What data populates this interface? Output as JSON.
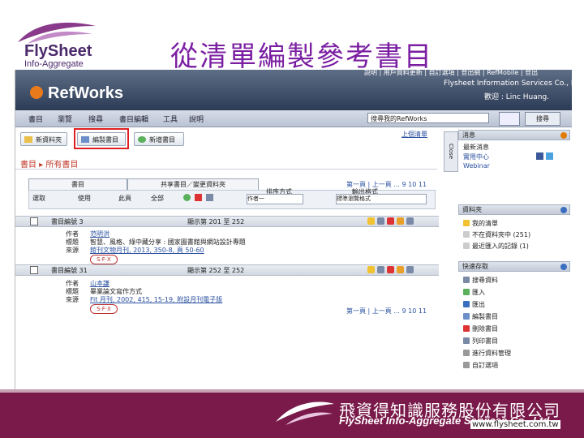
{
  "slide": {
    "logo_name": "FlySheet",
    "logo_tagline": "Info-Aggregate",
    "title": "從清單編製參考書目"
  },
  "topbar": {
    "links": "說明 | 用戶資料更新 | 自訂選項 | 登出網 | RefMobile | 登出",
    "app_name": "RefWorks",
    "org": "Flysheet Information Services Co., Ltd.",
    "user": "歡迎 : Linc Huang."
  },
  "nav": {
    "items": [
      "書目",
      "瀏覽",
      "搜尋",
      "書目編輯",
      "工具",
      "說明"
    ]
  },
  "search": {
    "value": "搜尋我的RefWorks",
    "button_label": "搜尋"
  },
  "toolbar": {
    "buttons": [
      "新資料夾",
      "編製書目",
      "新增書目"
    ],
    "last_list": "上個清單"
  },
  "breadcrumb": "書目 ▸ 所有書目",
  "tabs": [
    "書目",
    "共享書目／變更資料夾"
  ],
  "pager": "第一頁 | 上一頁 ... 9 10 11",
  "options": {
    "select_label": "選取",
    "view_label": "使用",
    "page_label": "此頁",
    "all_label": "全部",
    "sort_label": "排序方式",
    "sort_value": "作者一",
    "format_label": "輸出格式",
    "format_value": "標準瀏覽格式"
  },
  "records": [
    {
      "header": "書目編號 3",
      "range": "顯示第 201 至 252",
      "fields": [
        {
          "label": "作者",
          "value": "范明洪",
          "link": true
        },
        {
          "label": "標題",
          "value": "智慧、風格、綠中藏分享 : 國家圖書館與網站設計專題",
          "link": false
        },
        {
          "label": "來源",
          "value": "館刊文物月刊, 2013, 350-8, 頁 50-60",
          "link": true
        }
      ]
    },
    {
      "header": "書目編號 31",
      "range": "顯示第 252 至 252",
      "fields": [
        {
          "label": "作者",
          "value": "山本謙",
          "link": true
        },
        {
          "label": "標題",
          "value": "畢業論文寫作方式",
          "link": false
        },
        {
          "label": "來源",
          "value": "Fit 月刊, 2002, 415, 15-19, 附設月刊電子版",
          "link": true
        }
      ]
    }
  ],
  "sfx_label": "S·F·X",
  "sidebar": {
    "close_tab": "Close",
    "news_head": "消息",
    "news_items": [
      "最新消息",
      "實用中心",
      "Webinar"
    ],
    "folders_head": "資料夾",
    "folder_items": [
      {
        "label": "我的清單",
        "count": ""
      },
      {
        "label": "不在資料夾中",
        "count": "(251)"
      },
      {
        "label": "最近匯入的記錄",
        "count": "(1)"
      }
    ],
    "quick_head": "快速存取",
    "quick_items": [
      "搜尋資料",
      "匯入",
      "匯出",
      "編製書目",
      "刪除書目",
      "列印書目",
      "進行資料管理",
      "自訂選項"
    ]
  },
  "footer": {
    "company_zh": "飛資得知識服務股份有限公司",
    "company_en": "FlySheet Info-Aggregate Services Co., Ltd.",
    "url": "www.flysheet.com.tw"
  }
}
